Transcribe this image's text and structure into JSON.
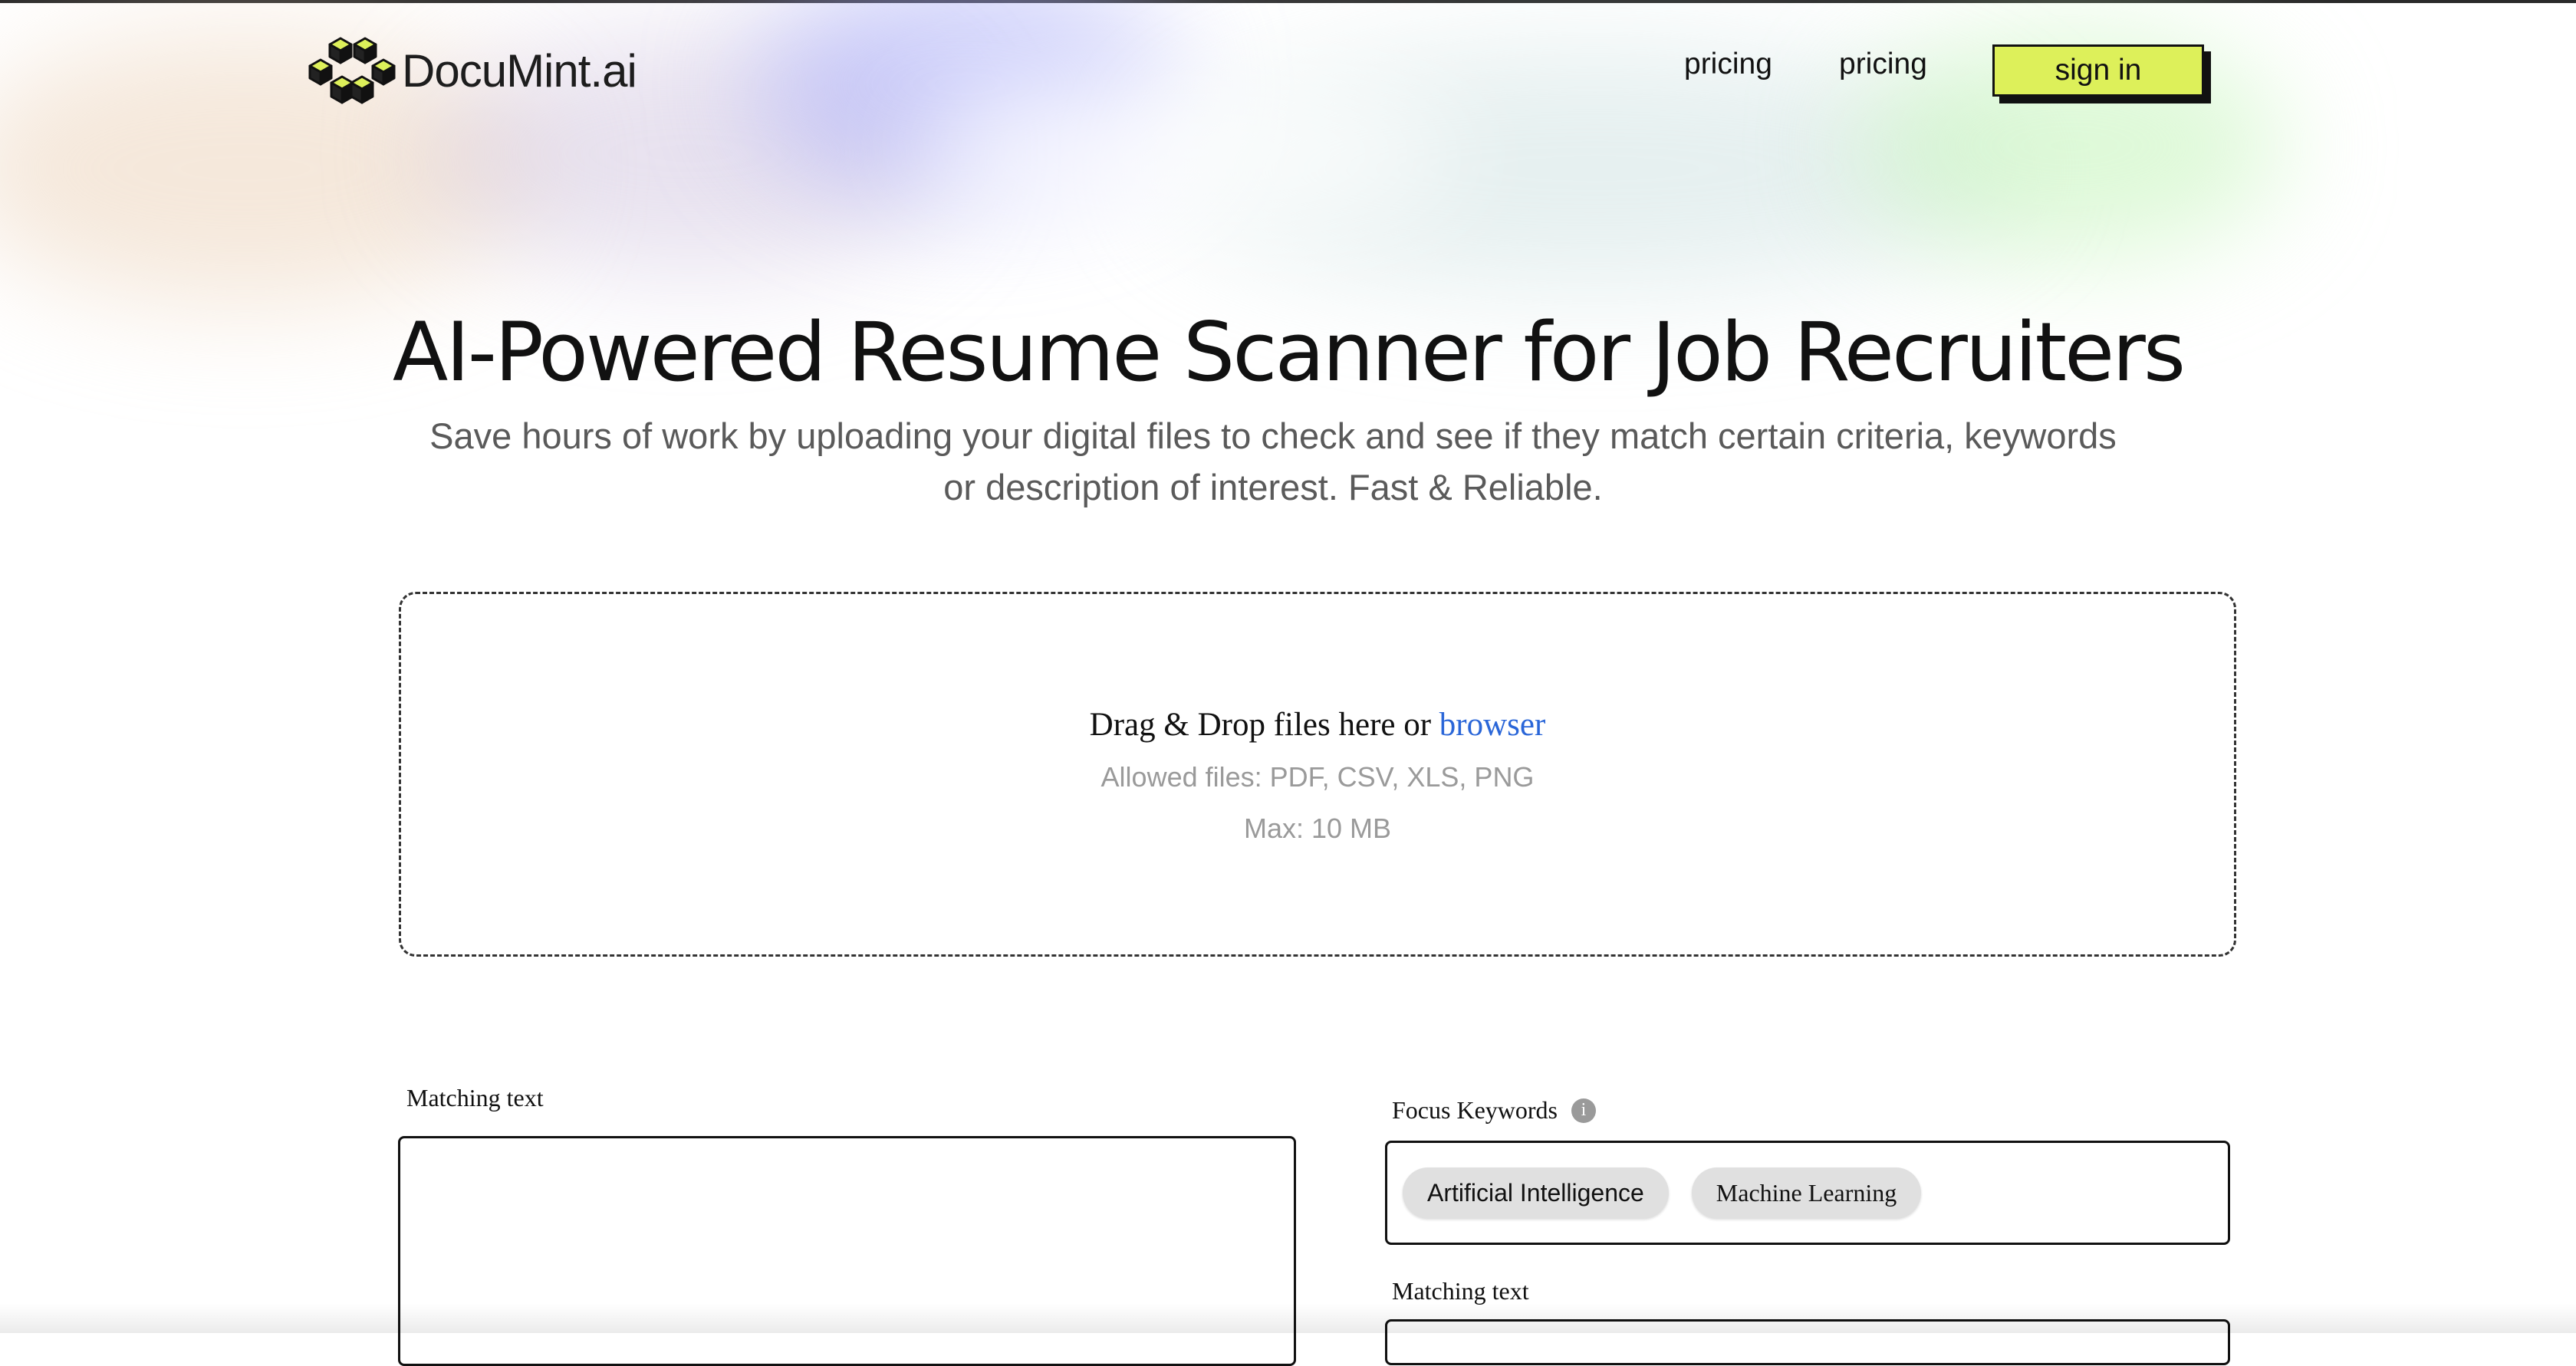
{
  "header": {
    "logo_text": "DocuMint.ai",
    "logo_icon": "cubes-logo-icon",
    "nav": [
      {
        "label": "pricing"
      },
      {
        "label": "pricing"
      }
    ],
    "signin_label": "sign in"
  },
  "hero": {
    "title": "AI-Powered Resume Scanner for Job Recruiters",
    "subtitle": "Save hours of work by uploading your digital files to check and see if they match certain criteria, keywords or description of interest. Fast & Reliable."
  },
  "dropzone": {
    "prompt": "Drag & Drop files here or",
    "browse_link": "browser",
    "allowed": "Allowed files: PDF, CSV, XLS, PNG",
    "max": "Max: 10 MB"
  },
  "matching_left": {
    "label": "Matching text",
    "value": ""
  },
  "focus_keywords": {
    "label": "Focus Keywords",
    "info_icon": "info-icon",
    "info_glyph": "i",
    "chips": [
      "Artificial Intelligence",
      "Machine Learning"
    ]
  },
  "matching_right": {
    "label": "Matching text",
    "value": ""
  },
  "colors": {
    "accent": "#ddf05a",
    "link": "#2a66d8",
    "muted_text": "#9a9a9a"
  }
}
